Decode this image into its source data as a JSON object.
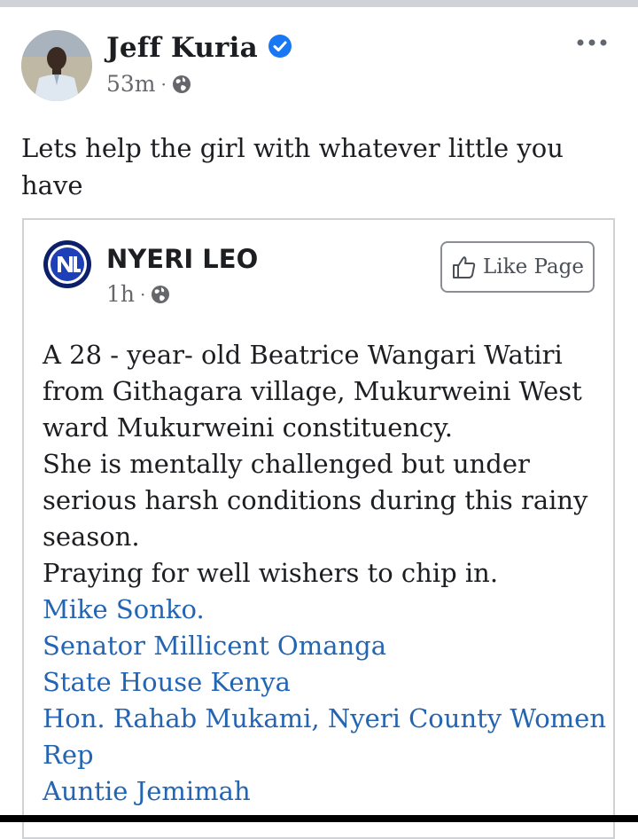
{
  "post": {
    "author": "Jeff Kuria",
    "time": "53m",
    "separator": "·",
    "text": "Lets help the girl with whatever little you have"
  },
  "shared": {
    "page_name": "NYERI LEO",
    "time": "1h",
    "separator": "·",
    "like_button": "Like Page",
    "body_lines": [
      "A 28 - year- old Beatrice Wangari Watiri from Githagara village, Mukurweini West ward Mukurweini constituency.",
      "She is mentally challenged but under serious harsh conditions during this rainy season.",
      "Praying for well wishers to chip in."
    ],
    "tags": [
      "Mike Sonko.",
      "Senator Millicent Omanga",
      "State House Kenya",
      "Hon. Rahab Mukami, Nyeri County Women Rep",
      "Auntie Jemimah"
    ]
  },
  "colors": {
    "link": "#2465b3",
    "verified": "#1877f2",
    "meta": "#65676b"
  },
  "icons": {
    "verified": "verified-badge-icon",
    "globe": "globe-icon",
    "more": "more-options-icon",
    "like": "thumbs-up-icon"
  }
}
